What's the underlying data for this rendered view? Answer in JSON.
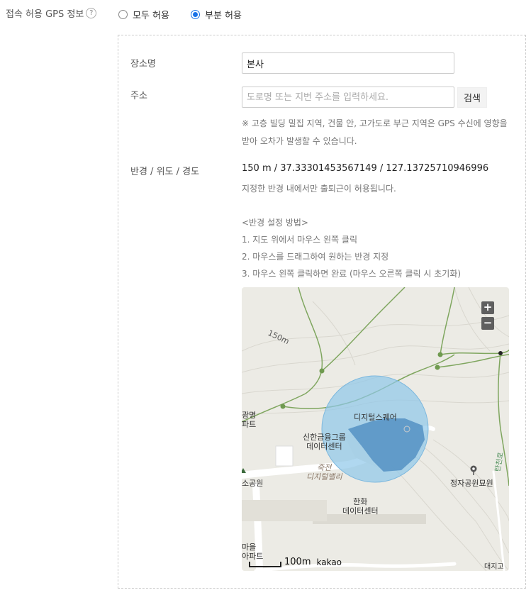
{
  "gps": {
    "label": "접속 허용 GPS 정보",
    "help_glyph": "?",
    "options": [
      {
        "label": "모두 허용",
        "checked": false
      },
      {
        "label": "부분 허용",
        "checked": true
      }
    ]
  },
  "form": {
    "place_label": "장소명",
    "place_value": "본사",
    "address_label": "주소",
    "address_placeholder": "도로명 또는 지번 주소를 입력하세요.",
    "search_button": "검색",
    "note_line1": "※ 고층 빌딩 밀집 지역, 건물 안, 고가도로 부근 지역은 GPS 수신에 영향을",
    "note_line2": "받아 오차가 발생할 수 있습니다.",
    "radius_label": "반경 / 위도 / 경도",
    "radius_value": "150 m / 37.33301453567149 / 127.13725710946996",
    "radius_hint": "지정한 반경 내에서만 출퇴근이 허용됩니다.",
    "guide_title": "<반경 설정 방법>",
    "guide_steps": [
      "1. 지도 위에서 마우스 왼쪽 클릭",
      "2. 마우스를 드래그하여 원하는 반경 지정",
      "3. 마우스 왼쪽 클릭하면 완료 (마우스 오른쪽 클릭 시 초기화)"
    ]
  },
  "map": {
    "zoom_in": "+",
    "zoom_out": "−",
    "contour_label": "150m",
    "labels": {
      "digital_square": "디지털스퀘어",
      "shinhan_1": "신한금융그룹",
      "shinhan_2": "데이터센터",
      "jukjeon_1": "죽전",
      "jukjeon_2": "디지털밸리",
      "hanwha_1": "한화",
      "hanwha_2": "데이터센터",
      "park": "정자공원묘원",
      "left_1": "광명",
      "left_2": "파트",
      "left_3": "소공원",
      "bottom_1": "마을",
      "bottom_2": "아파트",
      "road": "탄천로",
      "corner": "대지고"
    },
    "scale": "100m",
    "brand": "kakao",
    "accent": "#1a73e8",
    "radius_fill": "#8fc8ea"
  }
}
